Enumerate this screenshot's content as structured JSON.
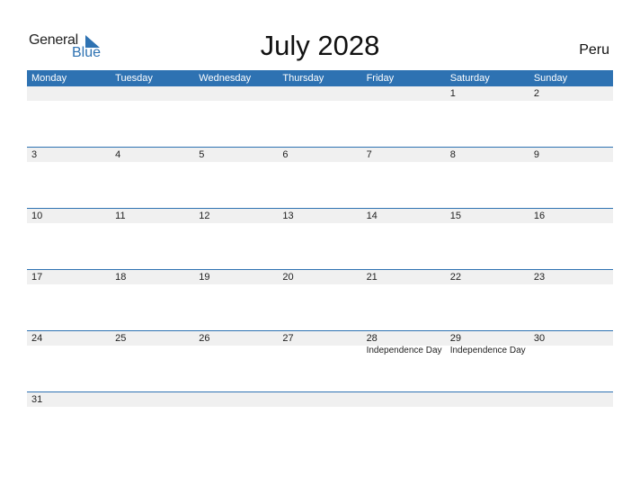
{
  "logo": {
    "general": "General",
    "blue": "Blue"
  },
  "title": "July 2028",
  "country": "Peru",
  "weekdays": [
    "Monday",
    "Tuesday",
    "Wednesday",
    "Thursday",
    "Friday",
    "Saturday",
    "Sunday"
  ],
  "weeks": [
    [
      {
        "d": ""
      },
      {
        "d": ""
      },
      {
        "d": ""
      },
      {
        "d": ""
      },
      {
        "d": ""
      },
      {
        "d": "1"
      },
      {
        "d": "2"
      }
    ],
    [
      {
        "d": "3"
      },
      {
        "d": "4"
      },
      {
        "d": "5"
      },
      {
        "d": "6"
      },
      {
        "d": "7"
      },
      {
        "d": "8"
      },
      {
        "d": "9"
      }
    ],
    [
      {
        "d": "10"
      },
      {
        "d": "11"
      },
      {
        "d": "12"
      },
      {
        "d": "13"
      },
      {
        "d": "14"
      },
      {
        "d": "15"
      },
      {
        "d": "16"
      }
    ],
    [
      {
        "d": "17"
      },
      {
        "d": "18"
      },
      {
        "d": "19"
      },
      {
        "d": "20"
      },
      {
        "d": "21"
      },
      {
        "d": "22"
      },
      {
        "d": "23"
      }
    ],
    [
      {
        "d": "24"
      },
      {
        "d": "25"
      },
      {
        "d": "26"
      },
      {
        "d": "27"
      },
      {
        "d": "28",
        "e": "Independence Day"
      },
      {
        "d": "29",
        "e": "Independence Day"
      },
      {
        "d": "30"
      }
    ],
    [
      {
        "d": "31"
      },
      {
        "d": ""
      },
      {
        "d": ""
      },
      {
        "d": ""
      },
      {
        "d": ""
      },
      {
        "d": ""
      },
      {
        "d": ""
      }
    ]
  ],
  "colors": {
    "accent": "#2e72b2",
    "band": "#f0f0f0"
  }
}
